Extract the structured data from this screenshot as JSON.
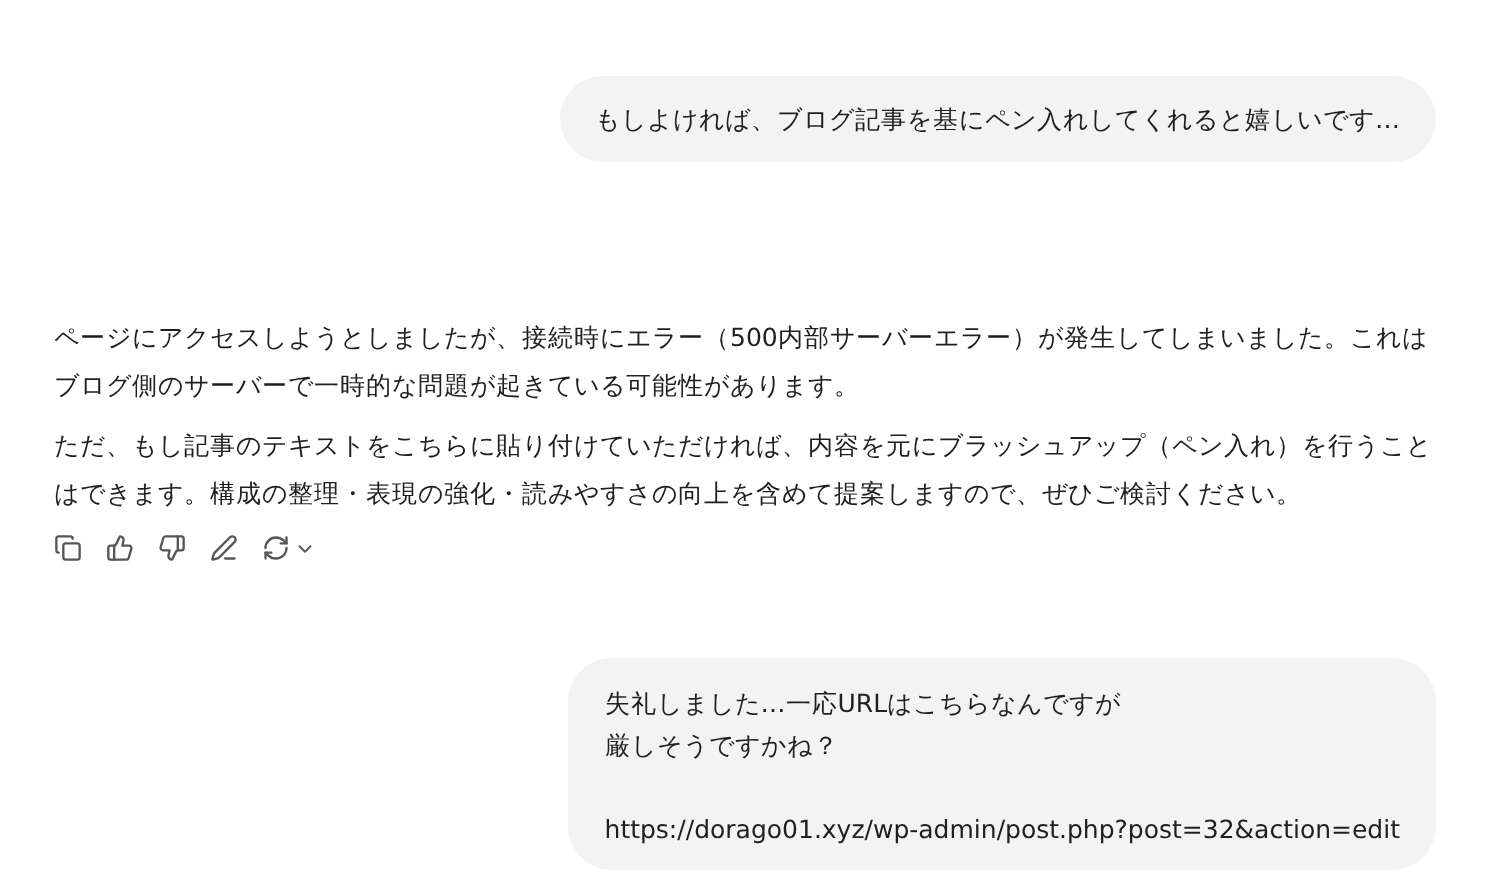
{
  "messages": [
    {
      "kind": "user",
      "paragraphs": [
        [
          "もしよければ、ブログ記事を基にペン入れしてくれると嬉しいです…"
        ]
      ]
    },
    {
      "kind": "assistant",
      "paragraphs": [
        "ページにアクセスしようとしましたが、接続時にエラー（500内部サーバーエラー）が発生してしまいました。これはブログ側のサーバーで一時的な問題が起きている可能性があります。",
        "ただ、もし記事のテキストをこちらに貼り付けていただければ、内容を元にブラッシュアップ（ペン入れ）を行うことはできます。構成の整理・表現の強化・読みやすさの向上を含めて提案しますので、ぜひご検討ください。"
      ]
    },
    {
      "kind": "user",
      "paragraphs": [
        [
          "失礼しました…一応URLはこちらなんですが",
          "厳しそうですかね？"
        ],
        [
          "https://dorago01.xyz/wp-admin/post.php?post=32&action=edit"
        ]
      ]
    }
  ]
}
